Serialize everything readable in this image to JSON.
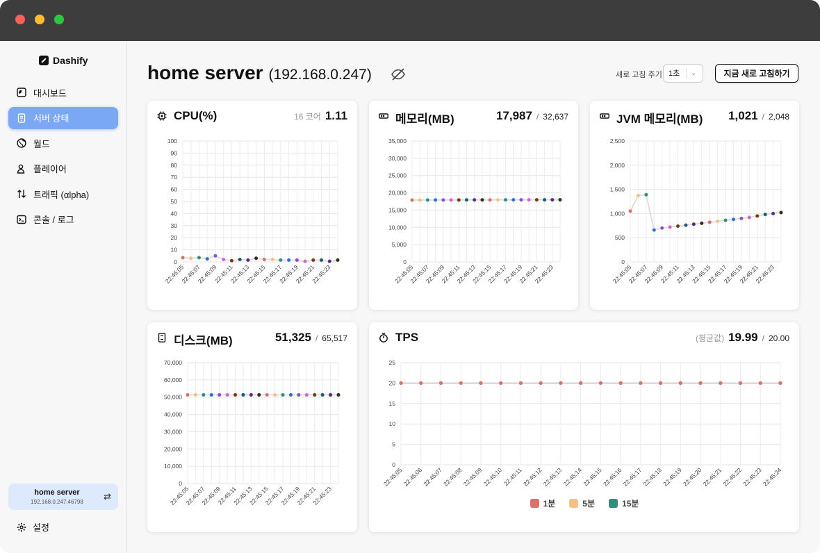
{
  "app": {
    "logo": "Dashify"
  },
  "sidebar": {
    "items": [
      {
        "label": "대시보드",
        "icon": "dashboard-icon",
        "active": false
      },
      {
        "label": "서버 상태",
        "icon": "server-icon",
        "active": true
      },
      {
        "label": "월드",
        "icon": "globe-icon",
        "active": false
      },
      {
        "label": "플레이어",
        "icon": "player-icon",
        "active": false
      },
      {
        "label": "트래픽 (αlpha)",
        "icon": "traffic-icon",
        "active": false
      },
      {
        "label": "콘솔 / 로그",
        "icon": "console-icon",
        "active": false
      }
    ],
    "server": {
      "name": "home server",
      "address": "192.168.0.247:46798"
    },
    "settings_label": "설정"
  },
  "header": {
    "title": "home server",
    "ip": "(192.168.0.247)",
    "refresh_label": "새로 고침 주기",
    "refresh_value": "1초",
    "refresh_button": "지금 새로 고침하기"
  },
  "colors": {
    "point_palette": [
      "#d9726b",
      "#f2c37e",
      "#2f8f7e",
      "#2f6fd0",
      "#8b4fd6",
      "#d066c8",
      "#7a3a10",
      "#1f5a6e",
      "#5a2a8a",
      "#3a2a1a"
    ],
    "legend_1m": "#d9726b",
    "legend_5m": "#f2c37e",
    "legend_15m": "#2f8f7e"
  },
  "cards": {
    "cpu": {
      "title": "CPU(%)",
      "note": "16 코어",
      "value": "1.11",
      "icon": "cpu-icon"
    },
    "memory": {
      "title": "메모리(MB)",
      "value": "17,987",
      "total": "32,637",
      "icon": "memory-icon"
    },
    "jvm": {
      "title": "JVM 메모리(MB)",
      "value": "1,021",
      "total": "2,048",
      "icon": "memory-icon"
    },
    "disk": {
      "title": "디스크(MB)",
      "value": "51,325",
      "total": "65,517",
      "icon": "disk-icon"
    },
    "tps": {
      "title": "TPS",
      "note": "(평균값)",
      "value": "19.99",
      "total": "20.00",
      "icon": "stopwatch-icon",
      "legend": [
        "1분",
        "5분",
        "15분"
      ]
    }
  },
  "chart_data": [
    {
      "id": "cpu",
      "type": "line",
      "title": "CPU(%)",
      "x": [
        "22:45:05",
        "22:45:06",
        "22:45:07",
        "22:45:08",
        "22:45:09",
        "22:45:10",
        "22:45:11",
        "22:45:12",
        "22:45:13",
        "22:45:14",
        "22:45:15",
        "22:45:16",
        "22:45:17",
        "22:45:18",
        "22:45:19",
        "22:45:20",
        "22:45:21",
        "22:45:22",
        "22:45:23",
        "22:45:24"
      ],
      "xticks": [
        "22:45:05",
        "22:45:07",
        "22:45:09",
        "22:45:11",
        "22:45:13",
        "22:45:15",
        "22:45:17",
        "22:45:19",
        "22:45:21",
        "22:45:23"
      ],
      "values": [
        3.5,
        3,
        3.5,
        2.5,
        5,
        2,
        1,
        2,
        1.5,
        3,
        2,
        2,
        1.5,
        1.5,
        1.5,
        0.5,
        1.5,
        1.5,
        0.5,
        1.5
      ],
      "ylim": [
        0,
        100
      ],
      "yticks": [
        0,
        10,
        20,
        30,
        40,
        50,
        60,
        70,
        80,
        90,
        100
      ],
      "grid": true
    },
    {
      "id": "memory",
      "type": "line",
      "title": "메모리(MB)",
      "x": [
        "22:45:05",
        "22:45:06",
        "22:45:07",
        "22:45:08",
        "22:45:09",
        "22:45:10",
        "22:45:11",
        "22:45:12",
        "22:45:13",
        "22:45:14",
        "22:45:15",
        "22:45:16",
        "22:45:17",
        "22:45:18",
        "22:45:19",
        "22:45:20",
        "22:45:21",
        "22:45:22",
        "22:45:23",
        "22:45:24"
      ],
      "xticks": [
        "22:45:05",
        "22:45:07",
        "22:45:09",
        "22:45:11",
        "22:45:13",
        "22:45:15",
        "22:45:17",
        "22:45:19",
        "22:45:21",
        "22:45:23"
      ],
      "values": [
        17900,
        17900,
        17920,
        17920,
        17930,
        17930,
        17940,
        17950,
        17950,
        17960,
        17960,
        17960,
        17970,
        17970,
        17980,
        17980,
        17980,
        17985,
        17987,
        17987
      ],
      "ylim": [
        0,
        35000
      ],
      "yticks": [
        0,
        5000,
        10000,
        15000,
        20000,
        25000,
        30000,
        35000
      ],
      "grid": true
    },
    {
      "id": "jvm",
      "type": "line",
      "title": "JVM 메모리(MB)",
      "x": [
        "22:45:05",
        "22:45:06",
        "22:45:07",
        "22:45:08",
        "22:45:09",
        "22:45:10",
        "22:45:11",
        "22:45:12",
        "22:45:13",
        "22:45:14",
        "22:45:15",
        "22:45:16",
        "22:45:17",
        "22:45:18",
        "22:45:19",
        "22:45:20",
        "22:45:21",
        "22:45:22",
        "22:45:23",
        "22:45:24"
      ],
      "xticks": [
        "22:45:05",
        "22:45:07",
        "22:45:09",
        "22:45:11",
        "22:45:13",
        "22:45:15",
        "22:45:17",
        "22:45:19",
        "22:45:21",
        "22:45:23"
      ],
      "values": [
        1050,
        1370,
        1390,
        660,
        700,
        720,
        740,
        760,
        780,
        800,
        820,
        840,
        860,
        880,
        900,
        920,
        950,
        980,
        1000,
        1021
      ],
      "ylim": [
        0,
        2500
      ],
      "yticks": [
        0,
        500,
        1000,
        1500,
        2000,
        2500
      ],
      "grid": true
    },
    {
      "id": "disk",
      "type": "line",
      "title": "디스크(MB)",
      "x": [
        "22:45:05",
        "22:45:06",
        "22:45:07",
        "22:45:08",
        "22:45:09",
        "22:45:10",
        "22:45:11",
        "22:45:12",
        "22:45:13",
        "22:45:14",
        "22:45:15",
        "22:45:16",
        "22:45:17",
        "22:45:18",
        "22:45:19",
        "22:45:20",
        "22:45:21",
        "22:45:22",
        "22:45:23",
        "22:45:24"
      ],
      "xticks": [
        "22:45:05",
        "22:45:07",
        "22:45:09",
        "22:45:11",
        "22:45:13",
        "22:45:15",
        "22:45:17",
        "22:45:19",
        "22:45:21",
        "22:45:23"
      ],
      "values": [
        51325,
        51325,
        51325,
        51325,
        51325,
        51325,
        51325,
        51325,
        51325,
        51325,
        51325,
        51325,
        51325,
        51325,
        51325,
        51325,
        51325,
        51325,
        51325,
        51325
      ],
      "ylim": [
        0,
        70000
      ],
      "yticks": [
        0,
        10000,
        20000,
        30000,
        40000,
        50000,
        60000,
        70000
      ],
      "grid": true
    },
    {
      "id": "tps",
      "type": "line",
      "title": "TPS",
      "x": [
        "22:45:05",
        "22:45:06",
        "22:45:07",
        "22:45:08",
        "22:45:09",
        "22:45:10",
        "22:45:11",
        "22:45:12",
        "22:45:13",
        "22:45:14",
        "22:45:15",
        "22:45:16",
        "22:45:17",
        "22:45:18",
        "22:45:19",
        "22:45:20",
        "22:45:21",
        "22:45:22",
        "22:45:23",
        "22:45:24"
      ],
      "xticks": [
        "22:45:05",
        "22:45:06",
        "22:45:07",
        "22:45:08",
        "22:45:09",
        "22:45:10",
        "22:45:11",
        "22:45:12",
        "22:45:13",
        "22:45:14",
        "22:45:15",
        "22:45:16",
        "22:45:17",
        "22:45:18",
        "22:45:19",
        "22:45:20",
        "22:45:21",
        "22:45:22",
        "22:45:23",
        "22:45:24"
      ],
      "series": [
        {
          "name": "1분",
          "values": [
            20,
            20,
            20,
            20,
            20,
            20,
            20,
            20,
            20,
            20,
            20,
            20,
            20,
            20,
            20,
            20,
            20,
            20,
            20,
            20
          ]
        },
        {
          "name": "5분",
          "values": [
            20,
            20,
            20,
            20,
            20,
            20,
            20,
            20,
            20,
            20,
            20,
            20,
            20,
            20,
            20,
            20,
            20,
            20,
            20,
            20
          ]
        },
        {
          "name": "15분",
          "values": [
            20,
            20,
            20,
            20,
            20,
            20,
            20,
            20,
            20,
            20,
            20,
            20,
            20,
            20,
            20,
            20,
            20,
            20,
            20,
            20
          ]
        }
      ],
      "ylim": [
        0,
        25
      ],
      "yticks": [
        0,
        5,
        10,
        15,
        20,
        25
      ],
      "grid": true,
      "legend": "bottom"
    }
  ]
}
